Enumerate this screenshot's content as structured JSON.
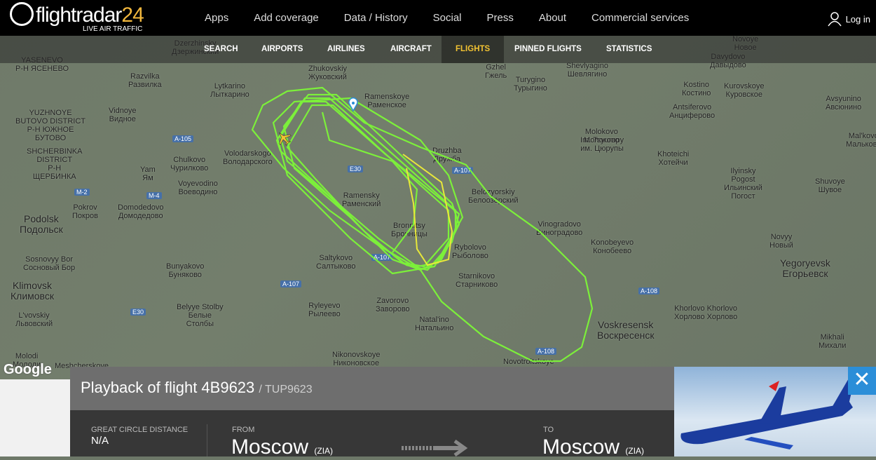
{
  "header": {
    "logo": "flightradar",
    "logo_num": "24",
    "logo_sub": "LIVE AIR TRAFFIC",
    "nav": [
      "Apps",
      "Add coverage",
      "Data / History",
      "Social",
      "Press",
      "About",
      "Commercial services"
    ],
    "login": "Log in"
  },
  "subnav": {
    "items": [
      "SEARCH",
      "AIRPORTS",
      "AIRLINES",
      "AIRCRAFT",
      "FLIGHTS",
      "PINNED FLIGHTS",
      "STATISTICS"
    ],
    "active": "FLIGHTS"
  },
  "map": {
    "labels": [
      "Dzerzhinsky\nДзержинский",
      "Zhukovskiy\nЖуковский",
      "Ramenskoye\nРаменское",
      "Lytkarino\nЛыткарино",
      "Razvilka\nРазвилка",
      "YASENEVO\nР-Н ЯСЕНЕВО",
      "Vidnoye\nВидное",
      "YUZHNOYE\nBUTOVO DISTRICT\nР-Н ЮЖНОЕ\nБУТОВО",
      "SHCHERBINKA\nDISTRICT\nР-Н\nЩЕРБИНКА",
      "Volodarskogo\nВолодарского",
      "Chulkovo\nЧурилково",
      "Yam\nЯм",
      "Voyevodino\nВоеводино",
      "Domodedovo\nДомодедово",
      "Pokrov\nПокров",
      "Podolsk\nПодольск",
      "Sosnovyy Bor\nСосновый Бор",
      "Bunyakovo\nБуняково",
      "Klimovsk\nКлимовск",
      "L'vovskiy\nЛьвовский",
      "Belyye Stolby\nБелые\nСтолбы",
      "Ryleyevo\nРылеево",
      "Saltykovo\nСалтыково",
      "Ramensky\nРаменский",
      "Bronnitsy\nБронницы",
      "Rybolovo\nРыболово",
      "Starnikovo\nСтарниково",
      "Zavorovo\nЗаворово",
      "Natal'ino\nНатальино",
      "Nikonovskoye\nНиконовское",
      "Novotroitskoye",
      "Druzhba\nДружба",
      "Belozyorskiy\nБелоозёрский",
      "Vinogradovo\nВиноградово",
      "Konobeyevo\nКонобеево",
      "Im. Tsyurupy\nим. Цюрупы",
      "Molokovo\nМолоково",
      "Turygino\nТурыгино",
      "Shevlyagino\nШевлягино",
      "Gzhel\nГжель",
      "Kostino\nКостино",
      "Antsiferovo\nАнциферово",
      "Khoteichi\nХотейчи",
      "Ilyinsky\nPogost\nИльинский\nПогост",
      "Shuvoye\nШувое",
      "Novyy\nНовый",
      "Yegoryevsk\nЕгорьевск",
      "Voskresensk\nВоскресенск",
      "Khorlovo Khorlovo\nХорлово Хорлово",
      "Mikhali\nМихали",
      "Davydovo\nДавыдово",
      "Kurovskoye\nКуровское",
      "Avsyunino\nАвсюнино",
      "Mal'kovo\nМальково",
      "Novoye\nНовое",
      "Molodi\nМолоди",
      "Meshcherskoye"
    ],
    "roads": [
      "A-105",
      "M-2",
      "M-4",
      "E30",
      "A-107",
      "A-107",
      "A-107",
      "E30",
      "A-108",
      "A-108"
    ],
    "attribution": "Google"
  },
  "playback": {
    "title": "Playback of flight 4B9623",
    "callsign": "/ TUP9623",
    "distance_label": "GREAT CIRCLE DISTANCE",
    "distance": "N/A",
    "from_label": "FROM",
    "from_city": "Moscow",
    "from_code": "(ZIA)",
    "to_label": "TO",
    "to_city": "Moscow",
    "to_code": "(ZIA)"
  },
  "colors": {
    "track": "#7cf03a",
    "track_alt": "#e8e83a",
    "accent": "#f1c232",
    "close": "#2b8ed8"
  },
  "icons": [
    "radar-logo-icon",
    "user-icon",
    "airport-pin-icon",
    "airplane-icon",
    "arrow-right-icon",
    "close-icon"
  ]
}
